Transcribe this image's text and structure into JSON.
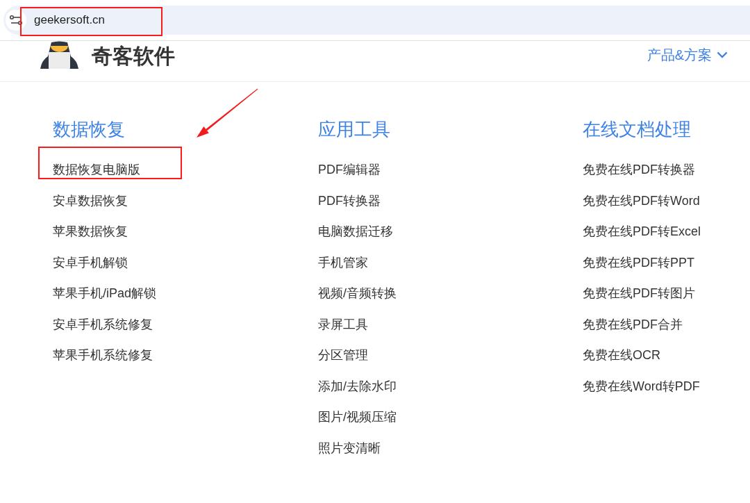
{
  "browser": {
    "address": "geekersoft.cn",
    "highlighted": true
  },
  "header": {
    "logo_text": "奇客软件",
    "nav_label": "产品&方案"
  },
  "columns": [
    {
      "title": "数据恢复",
      "items": [
        {
          "label": "数据恢复电脑版",
          "highlighted": true
        },
        {
          "label": "安卓数据恢复",
          "highlighted": false
        },
        {
          "label": "苹果数据恢复",
          "highlighted": false
        },
        {
          "label": "安卓手机解锁",
          "highlighted": false
        },
        {
          "label": "苹果手机/iPad解锁",
          "highlighted": false
        },
        {
          "label": "安卓手机系统修复",
          "highlighted": false
        },
        {
          "label": "苹果手机系统修复",
          "highlighted": false
        }
      ]
    },
    {
      "title": "应用工具",
      "items": [
        {
          "label": "PDF编辑器",
          "highlighted": false
        },
        {
          "label": "PDF转换器",
          "highlighted": false
        },
        {
          "label": "电脑数据迁移",
          "highlighted": false
        },
        {
          "label": "手机管家",
          "highlighted": false
        },
        {
          "label": "视频/音频转换",
          "highlighted": false
        },
        {
          "label": "录屏工具",
          "highlighted": false
        },
        {
          "label": "分区管理",
          "highlighted": false
        },
        {
          "label": "添加/去除水印",
          "highlighted": false
        },
        {
          "label": "图片/视频压缩",
          "highlighted": false
        },
        {
          "label": "照片变清晰",
          "highlighted": false
        }
      ]
    },
    {
      "title": "在线文档处理",
      "items": [
        {
          "label": "免费在线PDF转换器",
          "highlighted": false
        },
        {
          "label": "免费在线PDF转Word",
          "highlighted": false
        },
        {
          "label": "免费在线PDF转Excel",
          "highlighted": false
        },
        {
          "label": "免费在线PDF转PPT",
          "highlighted": false
        },
        {
          "label": "免费在线PDF转图片",
          "highlighted": false
        },
        {
          "label": "免费在线PDF合并",
          "highlighted": false
        },
        {
          "label": "免费在线OCR",
          "highlighted": false
        },
        {
          "label": "免费在线Word转PDF",
          "highlighted": false
        }
      ]
    }
  ]
}
